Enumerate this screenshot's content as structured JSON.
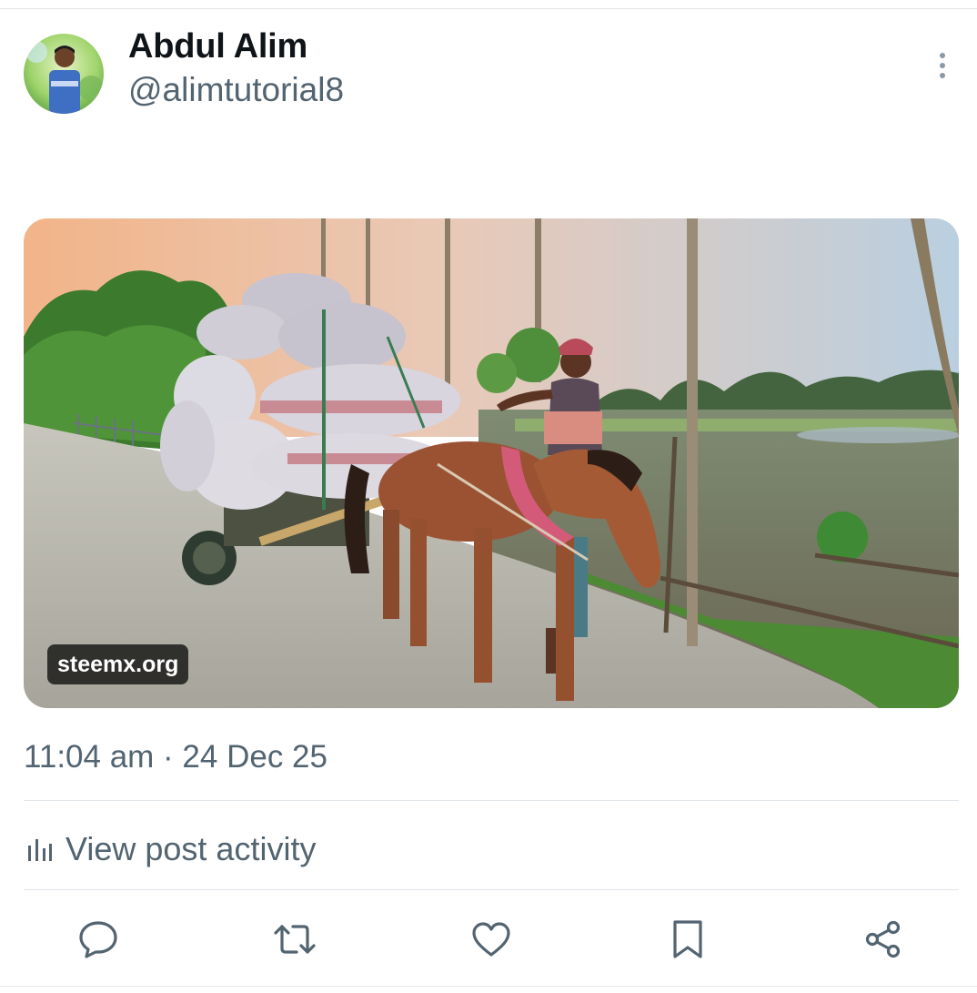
{
  "author": {
    "display_name": "Abdul Alim",
    "handle": "@alimtutorial8"
  },
  "post": {
    "media_watermark": "steemx.org",
    "timestamp": "11:04 am · 24 Dec 25",
    "activity_label": "View post activity"
  },
  "actions": [
    {
      "name": "reply",
      "icon": "speech-bubble-icon"
    },
    {
      "name": "repost",
      "icon": "repost-arrows-icon"
    },
    {
      "name": "like",
      "icon": "heart-icon"
    },
    {
      "name": "bookmark",
      "icon": "bookmark-icon"
    },
    {
      "name": "share",
      "icon": "share-icon"
    }
  ],
  "colors": {
    "text_primary": "#0f1419",
    "text_secondary": "#536471",
    "divider": "#e1e6ea"
  }
}
